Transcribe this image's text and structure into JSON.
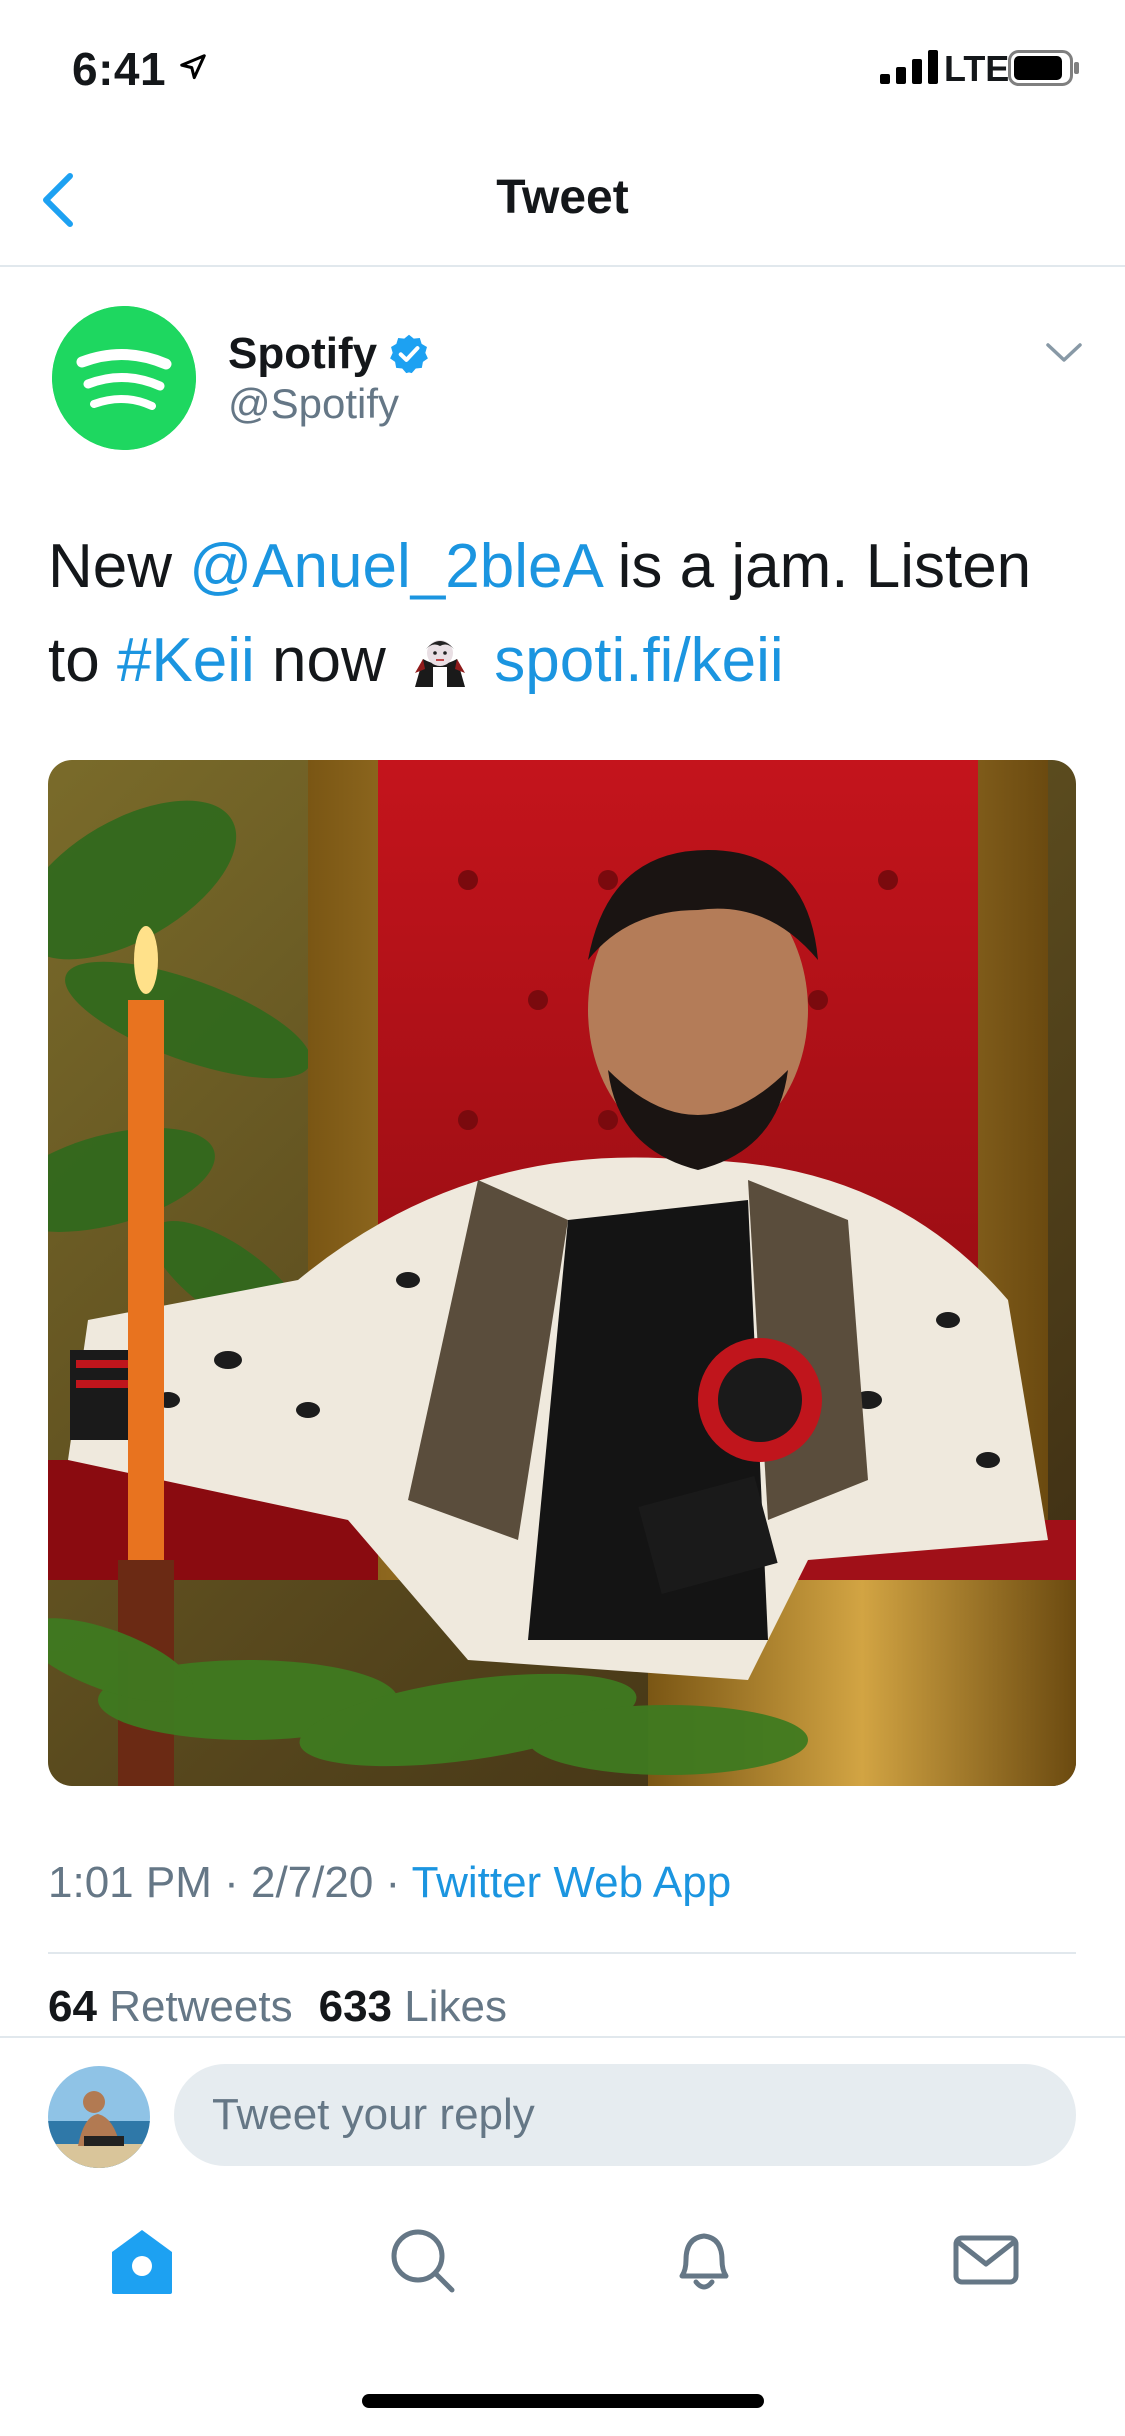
{
  "status_bar": {
    "time": "6:41",
    "network": "LTE"
  },
  "nav": {
    "title": "Tweet"
  },
  "tweet": {
    "author": {
      "name": "Spotify",
      "handle": "@Spotify"
    },
    "text": {
      "part1": "New ",
      "mention": "@Anuel_2bleA",
      "part2": " is a jam. Listen to ",
      "hashtag": "#Keii",
      "part3": " now",
      "emoji_icon": "vampire-emoji",
      "link": "spoti.fi/keii"
    },
    "meta": {
      "time": "1:01 PM",
      "sep1": " · ",
      "date": "2/7/20",
      "sep2": " · ",
      "source": "Twitter Web App"
    },
    "stats": {
      "retweets_count": "64",
      "retweets_label": "Retweets",
      "likes_count": "633",
      "likes_label": "Likes"
    }
  },
  "reply": {
    "placeholder": "Tweet your reply"
  },
  "tabbar": {
    "items": [
      "home-icon",
      "search-icon",
      "notifications-icon",
      "messages-icon"
    ],
    "active": "home-icon"
  },
  "colors": {
    "link": "#1b95e0",
    "spotify_green": "#1ed760",
    "muted": "#657786",
    "text": "#14171a"
  }
}
